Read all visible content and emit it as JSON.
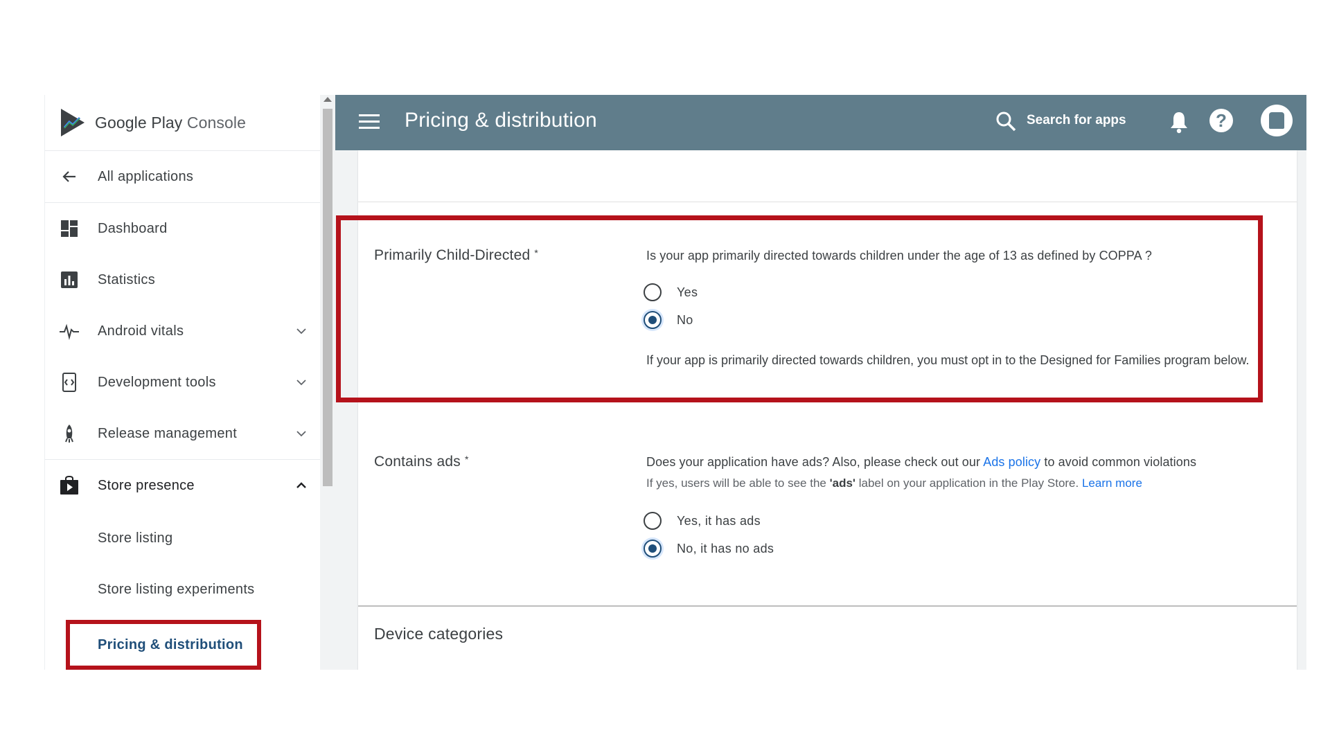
{
  "sidebar": {
    "logo": {
      "brand": "Google Play",
      "product": "Console"
    },
    "back": {
      "label": "All applications"
    },
    "items": [
      {
        "label": "Dashboard",
        "icon": "dashboard-icon"
      },
      {
        "label": "Statistics",
        "icon": "bar-chart-icon"
      },
      {
        "label": "Android vitals",
        "icon": "pulse-icon",
        "expandable": true
      },
      {
        "label": "Development tools",
        "icon": "code-icon",
        "expandable": true
      },
      {
        "label": "Release management",
        "icon": "rocket-icon",
        "expandable": true
      },
      {
        "label": "Store presence",
        "icon": "store-bag-icon",
        "expanded": true
      }
    ],
    "sub_items": [
      {
        "label": "Store listing"
      },
      {
        "label": "Store listing experiments"
      },
      {
        "label": "Pricing & distribution",
        "selected": true
      }
    ]
  },
  "topbar": {
    "title": "Pricing & distribution",
    "search_label": "Search for apps",
    "color": "#607d8b"
  },
  "child_directed": {
    "label": "Primarily Child-Directed",
    "required_mark": "*",
    "question": "Is your app primarily directed towards children under the age of 13 as defined by COPPA ?",
    "options": [
      "Yes",
      "No"
    ],
    "selected": "No",
    "note": "If your app is primarily directed towards children, you must opt in to the Designed for Families program below."
  },
  "ads": {
    "label": "Contains ads",
    "required_mark": "*",
    "question_prefix": "Does your application have ads? Also, please check out our ",
    "policy_link": "Ads policy",
    "question_suffix": " to avoid common violations",
    "help_prefix": "If yes, users will be able to see the ",
    "help_bold": "'ads'",
    "help_suffix": " label on your application in the Play Store. ",
    "learn_more": "Learn more",
    "options": [
      "Yes, it has ads",
      "No, it has no ads"
    ],
    "selected": "No, it has no ads"
  },
  "device_categories": {
    "title": "Device categories"
  },
  "colors": {
    "highlight": "#b5121b",
    "radio_selected": "#1f4e79",
    "link": "#1a73e8"
  }
}
